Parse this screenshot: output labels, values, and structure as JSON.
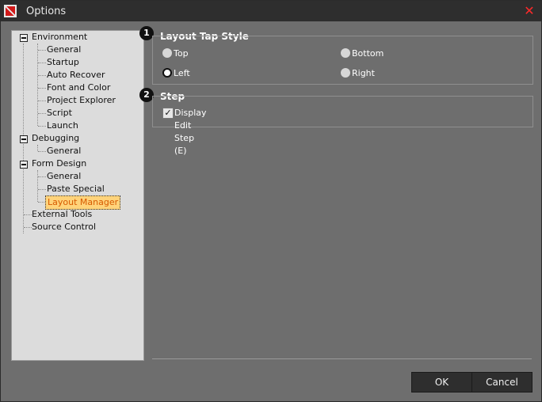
{
  "window": {
    "title": "Options",
    "close_glyph": "✕"
  },
  "tree": {
    "items": [
      {
        "label": "Environment"
      },
      {
        "label": "General"
      },
      {
        "label": "Startup"
      },
      {
        "label": "Auto Recover"
      },
      {
        "label": "Font and Color"
      },
      {
        "label": "Project Explorer"
      },
      {
        "label": "Script"
      },
      {
        "label": "Launch"
      },
      {
        "label": "Debugging"
      },
      {
        "label": "General"
      },
      {
        "label": "Form Design"
      },
      {
        "label": "General"
      },
      {
        "label": "Paste Special"
      },
      {
        "label": "Layout Manager",
        "selected": true
      },
      {
        "label": "External Tools"
      },
      {
        "label": "Source Control"
      }
    ]
  },
  "layout_tab_style": {
    "badge": "1",
    "title": "Layout Tap Style",
    "options": [
      {
        "label": "Top",
        "checked": false
      },
      {
        "label": "Bottom",
        "checked": false
      },
      {
        "label": "Left",
        "checked": true
      },
      {
        "label": "Right",
        "checked": false
      }
    ]
  },
  "step": {
    "badge": "2",
    "title": "Step",
    "display_edit_step_label": "Display Edit Step (E)",
    "display_edit_step_checked": true,
    "check_glyph": "✓"
  },
  "buttons": {
    "ok": "OK",
    "cancel": "Cancel"
  },
  "colors": {
    "selected_bg": "#ffd37a",
    "selected_text": "#d65a00",
    "panel_bg": "#6e6e6e"
  }
}
